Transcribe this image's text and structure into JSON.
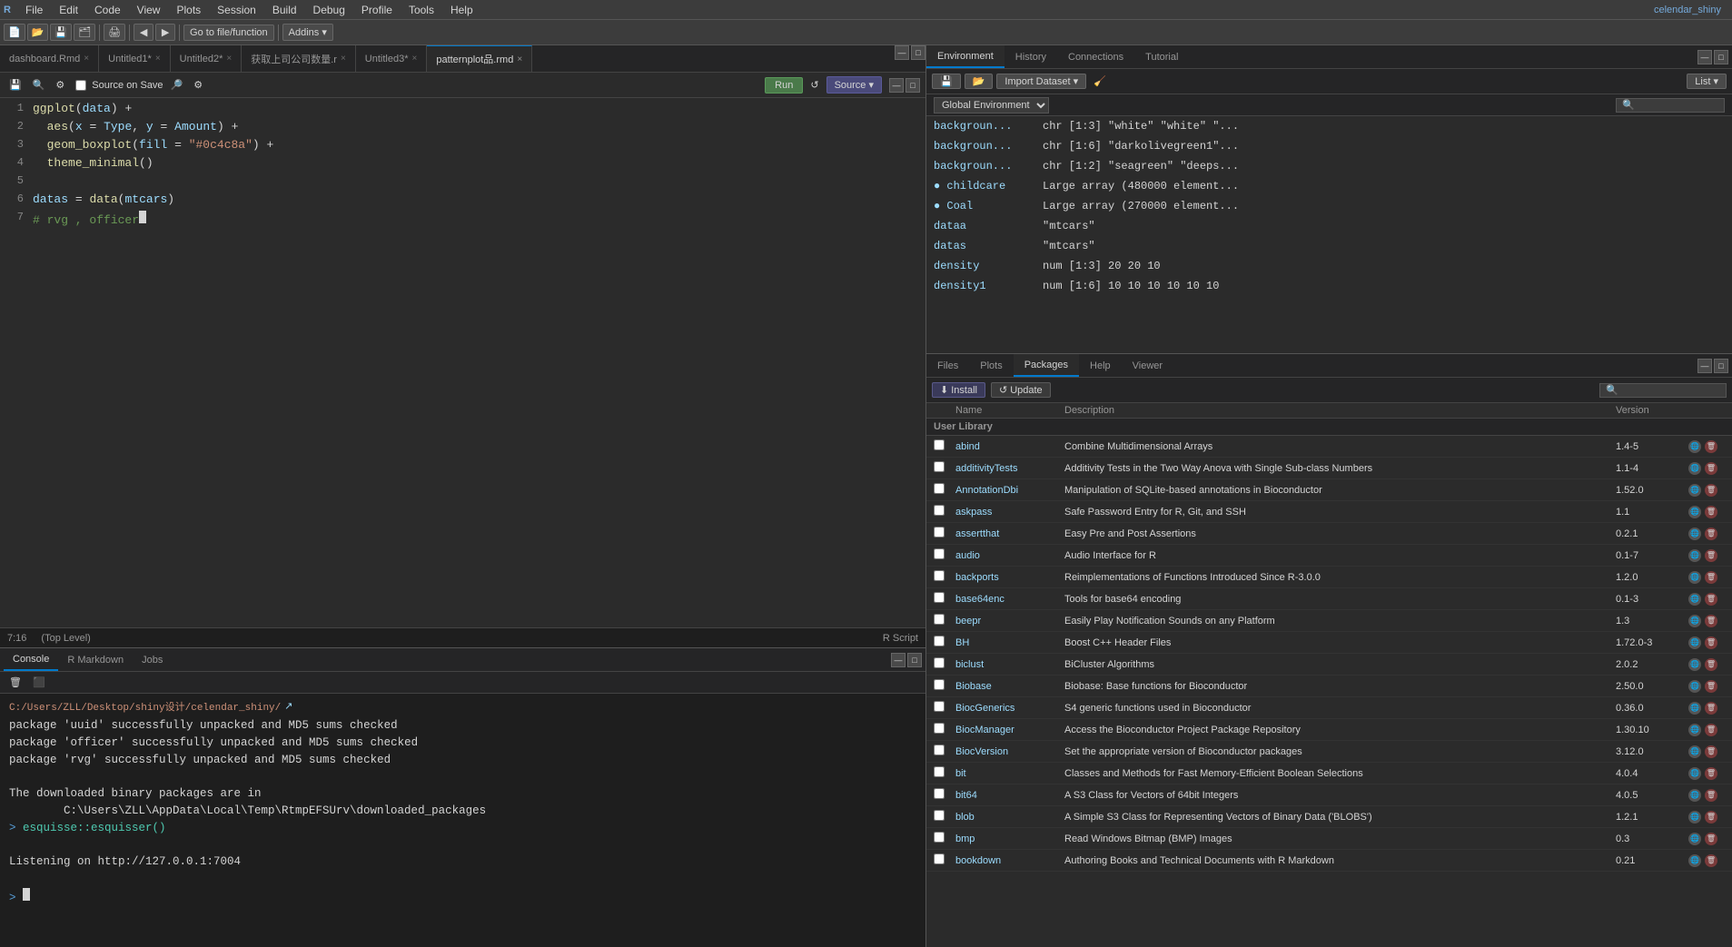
{
  "menu": {
    "items": [
      "File",
      "Edit",
      "Code",
      "View",
      "Plots",
      "Session",
      "Build",
      "Debug",
      "Profile",
      "Tools",
      "Help"
    ]
  },
  "top_toolbar": {
    "goto_label": "Go to file/function",
    "addins_label": "Addins ▾"
  },
  "editor_tabs": [
    {
      "label": "dashboard.Rmd",
      "active": false,
      "closable": true
    },
    {
      "label": "Untitled1*",
      "active": false,
      "closable": true
    },
    {
      "label": "Untitled2*",
      "active": false,
      "closable": true
    },
    {
      "label": "获取上司公司数量.r",
      "active": false,
      "closable": true
    },
    {
      "label": "Untitled3*",
      "active": false,
      "closable": true
    },
    {
      "label": "patternplot品.rmd",
      "active": true,
      "closable": true
    }
  ],
  "editor_toolbar": {
    "source_on_save_label": "Source on Save",
    "run_label": "Run",
    "source_label": "Source ▾"
  },
  "code_lines": [
    {
      "num": 1,
      "content": "ggplot(data) +"
    },
    {
      "num": 2,
      "content": "  aes(x = Type, y = Amount) +"
    },
    {
      "num": 3,
      "content": "  geom_boxplot(fill = \"#0c4c8a\") +"
    },
    {
      "num": 4,
      "content": "  theme_minimal()"
    },
    {
      "num": 5,
      "content": ""
    },
    {
      "num": 6,
      "content": "datas = data(mtcars)"
    },
    {
      "num": 7,
      "content": "# rvg , officer"
    }
  ],
  "editor_status": {
    "position": "7:16",
    "level": "(Top Level)",
    "script_type": "R Script"
  },
  "console_tabs": [
    "Console",
    "R Markdown",
    "Jobs"
  ],
  "console": {
    "path": "C:/Users/ZLL/Desktop/shiny设计/celendar_shiny/",
    "lines": [
      "package 'uuid' successfully unpacked and MD5 sums checked",
      "package 'officer' successfully unpacked and MD5 sums checked",
      "package 'rvg' successfully unpacked and MD5 sums checked",
      "",
      "The downloaded binary packages are in",
      "        C:\\Users\\ZLL\\AppData\\Local\\Temp\\RtmpEFSUrv\\downloaded_packages"
    ],
    "command": "esquisse::esquisser()",
    "listening": "Listening on http://127.0.0.1:7004",
    "prompt": ">"
  },
  "env_tabs": [
    "Environment",
    "History",
    "Connections",
    "Tutorial"
  ],
  "env_toolbar": {
    "import_label": "Import Dataset ▾",
    "list_label": "List ▾"
  },
  "env_dropdown": "Global Environment",
  "env_items": [
    {
      "name": "backgroun...",
      "value": "chr [1:3]  \"white\" \"white\" \"...",
      "dot": false
    },
    {
      "name": "backgroun...",
      "value": "chr [1:6]  \"darkolivegreen1\"...",
      "dot": false
    },
    {
      "name": "backgroun...",
      "value": "chr [1:2]  \"seagreen\" \"deeps...",
      "dot": false
    },
    {
      "name": "childcare",
      "value": "Large array (480000 element...",
      "dot": true
    },
    {
      "name": "Coal",
      "value": "Large array (270000 element...",
      "dot": true
    },
    {
      "name": "dataa",
      "value": "\"mtcars\"",
      "dot": false
    },
    {
      "name": "datas",
      "value": "\"mtcars\"",
      "dot": false
    },
    {
      "name": "density",
      "value": "num [1:3]  20 20 10",
      "dot": false
    },
    {
      "name": "density1",
      "value": "num [1:6]  10 10 10 10 10 10",
      "dot": false
    }
  ],
  "files_tabs": [
    "Files",
    "Plots",
    "Packages",
    "Help",
    "Viewer"
  ],
  "packages_toolbar": {
    "install_label": "Install",
    "update_label": "Update"
  },
  "pkg_columns": {
    "name": "Name",
    "description": "Description",
    "version": "Version"
  },
  "pkg_section": "User Library",
  "packages": [
    {
      "name": "abind",
      "desc": "Combine Multidimensional Arrays",
      "version": "1.4-5"
    },
    {
      "name": "additivityTests",
      "desc": "Additivity Tests in the Two Way Anova with Single Sub-class Numbers",
      "version": "1.1-4"
    },
    {
      "name": "AnnotationDbi",
      "desc": "Manipulation of SQLite-based annotations in Bioconductor",
      "version": "1.52.0"
    },
    {
      "name": "askpass",
      "desc": "Safe Password Entry for R, Git, and SSH",
      "version": "1.1"
    },
    {
      "name": "assertthat",
      "desc": "Easy Pre and Post Assertions",
      "version": "0.2.1"
    },
    {
      "name": "audio",
      "desc": "Audio Interface for R",
      "version": "0.1-7"
    },
    {
      "name": "backports",
      "desc": "Reimplementations of Functions Introduced Since R-3.0.0",
      "version": "1.2.0"
    },
    {
      "name": "base64enc",
      "desc": "Tools for base64 encoding",
      "version": "0.1-3"
    },
    {
      "name": "beepr",
      "desc": "Easily Play Notification Sounds on any Platform",
      "version": "1.3"
    },
    {
      "name": "BH",
      "desc": "Boost C++ Header Files",
      "version": "1.72.0-3"
    },
    {
      "name": "biclust",
      "desc": "BiCluster Algorithms",
      "version": "2.0.2"
    },
    {
      "name": "Biobase",
      "desc": "Biobase: Base functions for Bioconductor",
      "version": "2.50.0"
    },
    {
      "name": "BiocGenerics",
      "desc": "S4 generic functions used in Bioconductor",
      "version": "0.36.0"
    },
    {
      "name": "BiocManager",
      "desc": "Access the Bioconductor Project Package Repository",
      "version": "1.30.10"
    },
    {
      "name": "BiocVersion",
      "desc": "Set the appropriate version of Bioconductor packages",
      "version": "3.12.0"
    },
    {
      "name": "bit",
      "desc": "Classes and Methods for Fast Memory-Efficient Boolean Selections",
      "version": "4.0.4"
    },
    {
      "name": "bit64",
      "desc": "A S3 Class for Vectors of 64bit Integers",
      "version": "4.0.5"
    },
    {
      "name": "blob",
      "desc": "A Simple S3 Class for Representing Vectors of Binary Data ('BLOBS')",
      "version": "1.2.1"
    },
    {
      "name": "bmp",
      "desc": "Read Windows Bitmap (BMP) Images",
      "version": "0.3"
    },
    {
      "name": "bookdown",
      "desc": "Authoring Books and Technical Documents with R Markdown",
      "version": "0.21"
    }
  ],
  "rstudio": {
    "title": "celendar_shiny",
    "window_title": "RStudio"
  }
}
